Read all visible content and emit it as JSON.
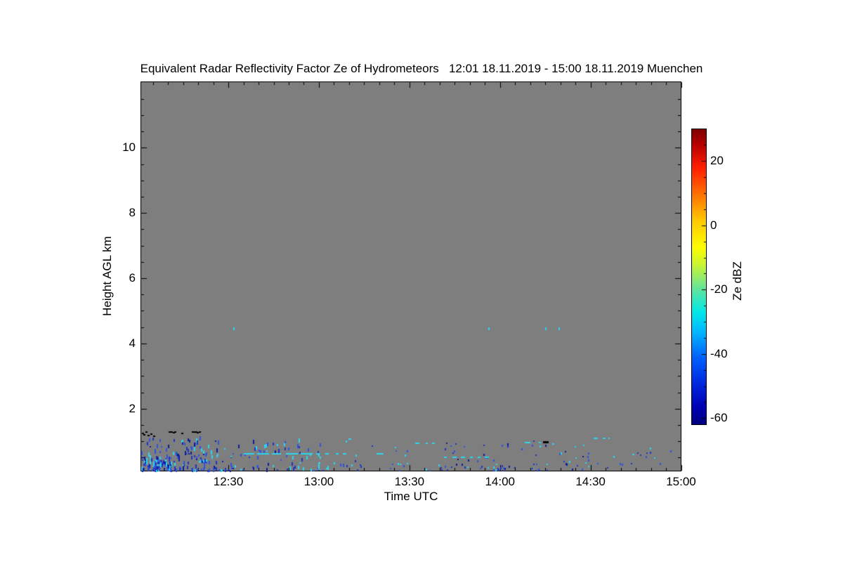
{
  "title": "Equivalent Radar Reflectivity Factor Ze of Hydrometeors   12:01 18.11.2019 - 15:00 18.11.2019 Muenchen",
  "axes": {
    "xlabel": "Time UTC",
    "ylabel": "Height AGL km",
    "x_major_ticks": [
      {
        "minutes": 30,
        "label": "12:30"
      },
      {
        "minutes": 60,
        "label": "13:00"
      },
      {
        "minutes": 90,
        "label": "13:30"
      },
      {
        "minutes": 120,
        "label": "14:00"
      },
      {
        "minutes": 150,
        "label": "14:30"
      },
      {
        "minutes": 180,
        "label": "15:00"
      }
    ],
    "x_minor_step_minutes": 5,
    "y_major_ticks": [
      {
        "km": 2,
        "label": "2"
      },
      {
        "km": 4,
        "label": "4"
      },
      {
        "km": 6,
        "label": "6"
      },
      {
        "km": 8,
        "label": "8"
      },
      {
        "km": 10,
        "label": "10"
      }
    ],
    "y_minor_step_km": 0.5,
    "time_start_label": "12:01",
    "time_range_minutes": [
      1,
      180
    ],
    "height_range_km": [
      0.09,
      12.02
    ]
  },
  "colorbar": {
    "label": "Ze dBZ",
    "range_dbz": [
      -62,
      30
    ],
    "major_ticks": [
      {
        "dbz": 20,
        "label": "20"
      },
      {
        "dbz": 0,
        "label": "0"
      },
      {
        "dbz": -20,
        "label": "-20"
      },
      {
        "dbz": -40,
        "label": "-40"
      },
      {
        "dbz": -60,
        "label": "-60"
      }
    ],
    "minor_step_dbz": 5,
    "gradient_top_to_bottom": [
      "#7f0000 0%",
      "#b40000 5%",
      "#ff1e00 13%",
      "#ff7a00 23%",
      "#ffc800 31%",
      "#fdfd00 40%",
      "#c8f432 46%",
      "#64e49b 54%",
      "#00e8e8 62%",
      "#00b4ff 69%",
      "#0064ff 77%",
      "#0028e0 86%",
      "#0000b4 94%",
      "#000080 100%"
    ]
  },
  "palette": {
    "plot_bg": "#7e7e7e",
    "frame": "#000000",
    "page_bg": "#ffffff",
    "cyan": "#2bd7ee",
    "blue": "#2e53e0",
    "deepblue": "#1f35c2",
    "navy": "#0b1d9b",
    "black": "#000000"
  },
  "chart_data": {
    "type": "heatmap",
    "title": "Equivalent Radar Reflectivity Factor Ze of Hydrometeors   12:01 18.11.2019 - 15:00 18.11.2019 Muenchen",
    "xlabel": "Time UTC",
    "ylabel": "Height AGL km",
    "x_domain_utc": [
      "12:01",
      "15:00"
    ],
    "y_domain_km": [
      0.09,
      12.02
    ],
    "colorbar_label": "Ze dBZ",
    "colorbar_ticks_dbz": [
      20,
      0,
      -20,
      -40,
      -60
    ],
    "note": "Field is almost entirely no-signal gray; weak scattered echoes (about -30 to -55 dBZ, cyan/blue specks) below ~1.3 km AGL over the whole period, a few isolated cyan specks near 4.45 km, and black clutter marks near 1.2-1.3 km between 12:01-12:22 and ~14:15.",
    "black_marks": {
      "points_t_h": [
        [
          1.3,
          1.27
        ],
        [
          1.8,
          1.22
        ],
        [
          2.5,
          1.3
        ],
        [
          3.2,
          1.19
        ],
        [
          4.1,
          1.24
        ],
        [
          5.0,
          1.18
        ],
        [
          10.3,
          1.3
        ],
        [
          10.9,
          1.31
        ],
        [
          11.5,
          1.29
        ],
        [
          12.1,
          1.3
        ],
        [
          14.3,
          1.27
        ],
        [
          17.8,
          1.3
        ],
        [
          18.4,
          1.31
        ],
        [
          19.0,
          1.3
        ],
        [
          19.6,
          1.29
        ],
        [
          20.2,
          1.3
        ]
      ],
      "dashes_t0_t1_h": [
        [
          134.3,
          136.2,
          0.99
        ]
      ]
    },
    "high_specks_cyan_t_h": [
      [
        31.7,
        4.45
      ],
      [
        116.1,
        4.45
      ],
      [
        134.9,
        4.45
      ],
      [
        139.3,
        4.45
      ]
    ],
    "cyan_dashes": [
      {
        "h": 0.62,
        "segments": [
          [
            35,
            38.5
          ],
          [
            39.5,
            43.5
          ],
          [
            44.5,
            47.5
          ],
          [
            49,
            53
          ],
          [
            54,
            58
          ],
          [
            59,
            60.2
          ],
          [
            62,
            63.2
          ],
          [
            65.5,
            66.5
          ],
          [
            68,
            69.2
          ],
          [
            79,
            81.3
          ]
        ]
      },
      {
        "h": 1.08,
        "segments": [
          [
            69.8,
            70.8
          ]
        ]
      },
      {
        "h": 0.95,
        "segments": [
          [
            92,
            93.3
          ],
          [
            95.3,
            95.9
          ],
          [
            97.4,
            98.3
          ]
        ]
      },
      {
        "h": 0.52,
        "segments": [
          [
            101.5,
            102.5
          ],
          [
            104.3,
            105.8
          ],
          [
            107,
            108.5
          ],
          [
            110,
            111
          ],
          [
            112.5,
            113.5
          ],
          [
            115,
            116.5
          ]
        ]
      },
      {
        "h": 0.97,
        "segments": [
          [
            128.3,
            130.2
          ],
          [
            132.8,
            133.4
          ]
        ]
      },
      {
        "h": 0.92,
        "segments": [
          [
            137.4,
            138.2
          ]
        ]
      },
      {
        "h": 1.1,
        "segments": [
          [
            151,
            152.5
          ],
          [
            154,
            155
          ],
          [
            155.8,
            156.3
          ]
        ]
      },
      {
        "h": 0.6,
        "segments": [
          [
            163.9,
            164.7
          ]
        ]
      }
    ],
    "extra_points": [
      {
        "color": "navy",
        "t_h": [
          [
            105.4,
            0.28
          ],
          [
            107.3,
            0.28
          ],
          [
            121.5,
            0.15
          ]
        ]
      },
      {
        "color": "blue",
        "t_h": [
          [
            149,
            0.5
          ],
          [
            149.2,
            0.62
          ],
          [
            149.1,
            0.4
          ],
          [
            120.5,
            0.85
          ],
          [
            127,
            0.75
          ],
          [
            173,
            0.3
          ],
          [
            176.5,
            0.69
          ]
        ]
      },
      {
        "color": "cyan",
        "t_h": [
          [
            86,
            0.3
          ],
          [
            88.5,
            0.55
          ]
        ]
      }
    ],
    "noise_clusters": [
      {
        "t": [
          1,
          28
        ],
        "h": [
          0.08,
          1.05
        ],
        "n": 150,
        "bias": 1.9,
        "colors": [
          "blue",
          "blue",
          "deepblue",
          "cyan",
          "navy"
        ],
        "seed": 7,
        "streak": true
      },
      {
        "t": [
          1,
          14
        ],
        "h": [
          0.08,
          0.5
        ],
        "n": 60,
        "bias": 1.2,
        "colors": [
          "cyan",
          "blue",
          "navy",
          "deepblue"
        ],
        "seed": 11,
        "streak": true
      },
      {
        "t": [
          28,
          48
        ],
        "h": [
          0.08,
          0.95
        ],
        "n": 45,
        "bias": 1.7,
        "colors": [
          "blue",
          "deepblue",
          "cyan",
          "navy"
        ],
        "seed": 13,
        "streak": true
      },
      {
        "t": [
          48,
          69
        ],
        "h": [
          0.1,
          1.1
        ],
        "n": 40,
        "bias": 1.6,
        "colors": [
          "blue",
          "cyan",
          "deepblue"
        ],
        "seed": 17,
        "streak": true
      },
      {
        "t": [
          69,
          100
        ],
        "h": [
          0.1,
          0.9
        ],
        "n": 20,
        "bias": 1.5,
        "colors": [
          "blue",
          "cyan",
          "deepblue"
        ],
        "seed": 19,
        "streak": false
      },
      {
        "t": [
          100,
          125
        ],
        "h": [
          0.1,
          0.95
        ],
        "n": 40,
        "bias": 1.5,
        "colors": [
          "blue",
          "cyan",
          "deepblue",
          "navy"
        ],
        "seed": 23,
        "streak": false
      },
      {
        "t": [
          125,
          152
        ],
        "h": [
          0.1,
          1.0
        ],
        "n": 30,
        "bias": 1.4,
        "colors": [
          "blue",
          "cyan",
          "deepblue",
          "navy"
        ],
        "seed": 29,
        "streak": false
      },
      {
        "t": [
          152,
          172
        ],
        "h": [
          0.12,
          0.8
        ],
        "n": 13,
        "bias": 1.4,
        "colors": [
          "blue",
          "cyan",
          "deepblue"
        ],
        "seed": 31,
        "streak": false
      }
    ]
  }
}
